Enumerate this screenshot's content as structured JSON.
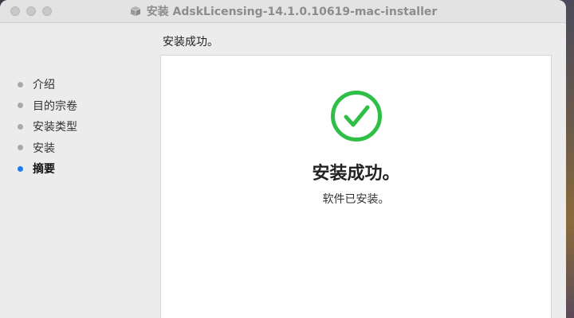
{
  "window": {
    "title": "安装 AdskLicensing-14.1.0.10619-mac-installer"
  },
  "heading": "安装成功。",
  "sidebar": {
    "items": [
      {
        "label": "介绍",
        "state": "done"
      },
      {
        "label": "目的宗卷",
        "state": "done"
      },
      {
        "label": "安装类型",
        "state": "done"
      },
      {
        "label": "安装",
        "state": "done"
      },
      {
        "label": "摘要",
        "state": "active"
      }
    ]
  },
  "main": {
    "icon": "checkmark-circle-icon",
    "success_title": "安装成功。",
    "success_message": "软件已安装。"
  },
  "colors": {
    "success_green": "#2fbf46",
    "active_bullet": "#1f7cf0",
    "inactive_bullet": "#a9a9a9"
  }
}
